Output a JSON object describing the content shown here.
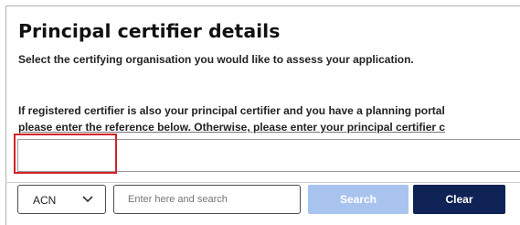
{
  "page": {
    "title": "Principal certifier details",
    "subtitle": "Select the certifying organisation you would like to assess your application.",
    "info_line1": "If registered certifier is also your principal certifier and you have a planning portal",
    "info_line2": "please enter the reference below. Otherwise, please enter your principal certifier c"
  },
  "reference_field": {
    "value": ""
  },
  "search_bar": {
    "type_selected": "ACN",
    "placeholder": "Enter here and search",
    "search_label": "Search",
    "clear_label": "Clear"
  },
  "colors": {
    "highlight": "#d2232a",
    "search_button": "#a8c4ee",
    "clear_button": "#0f2356"
  }
}
